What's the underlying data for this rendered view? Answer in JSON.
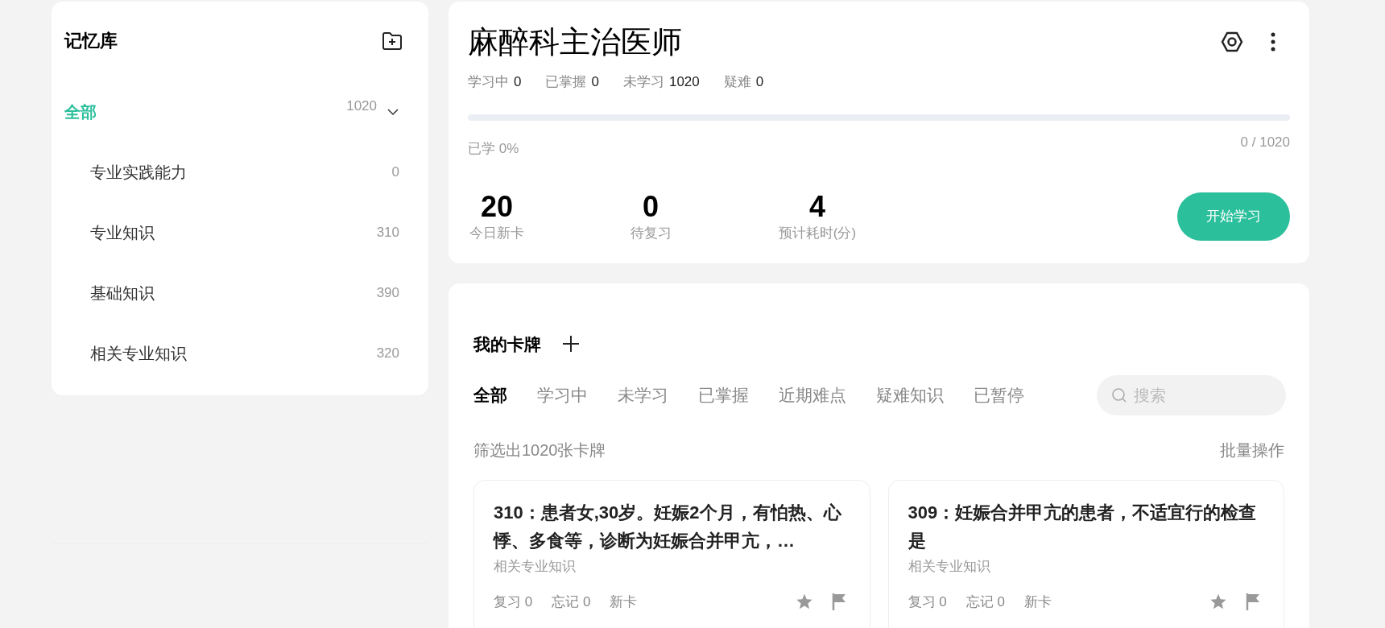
{
  "sidebar": {
    "title": "记忆库",
    "items": [
      {
        "label": "全部",
        "count": "1020",
        "selected": true,
        "expanded": true,
        "children": [
          {
            "label": "专业实践能力",
            "count": "0",
            "selected": false
          },
          {
            "label": "专业知识",
            "count": "310",
            "selected": false
          },
          {
            "label": "基础知识",
            "count": "390",
            "selected": false
          },
          {
            "label": "相关专业知识",
            "count": "320",
            "selected": false
          }
        ]
      }
    ]
  },
  "deck": {
    "title": "麻醉科主治医师",
    "stats": [
      {
        "label": "学习中",
        "value": "0"
      },
      {
        "label": "已掌握",
        "value": "0"
      },
      {
        "label": "未学习",
        "value": "1020"
      },
      {
        "label": "疑难",
        "value": "0"
      }
    ],
    "progress": {
      "level": 0,
      "label": "已学 0%",
      "reading": "0 / 1020"
    },
    "summary": [
      {
        "value": "20",
        "label": "今日新卡"
      },
      {
        "value": "0",
        "label": "待复习"
      },
      {
        "value": "4",
        "label": "预计耗时(分)"
      }
    ],
    "start_button": "开始学习"
  },
  "cards_panel": {
    "title": "我的卡牌",
    "tabs": [
      {
        "label": "全部",
        "selected": true
      },
      {
        "label": "学习中",
        "selected": false
      },
      {
        "label": "未学习",
        "selected": false
      },
      {
        "label": "已掌握",
        "selected": false
      },
      {
        "label": "近期难点",
        "selected": false
      },
      {
        "label": "疑难知识",
        "selected": false
      },
      {
        "label": "已暂停",
        "selected": false
      }
    ],
    "search": {
      "placeholder": "搜索"
    },
    "filter_summary": "筛选出1020张卡牌",
    "batch_action": "批量操作",
    "cards": [
      {
        "title": "310：患者女,30岁。妊娠2个月，有怕热、心悸、多食等，诊断为妊娠合并甲亢，…",
        "category": "相关专业知识",
        "review": "复习 0",
        "forget": "忘记 0",
        "status": "新卡"
      },
      {
        "title": "309：妊娠合并甲亢的患者，不适宜行的检查是",
        "category": "相关专业知识",
        "review": "复习 0",
        "forget": "忘记 0",
        "status": "新卡"
      }
    ]
  }
}
